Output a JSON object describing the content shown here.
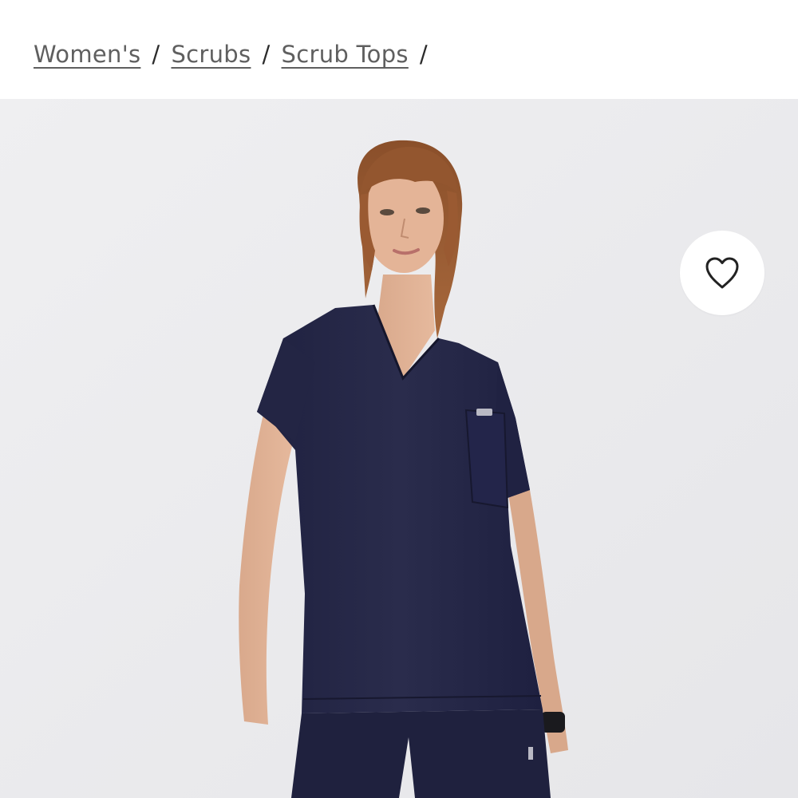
{
  "breadcrumb": {
    "items": [
      {
        "label": "Women's"
      },
      {
        "label": "Scrubs"
      },
      {
        "label": "Scrub Tops"
      }
    ],
    "separator": "/"
  },
  "product_image": {
    "subject": "model wearing navy scrub top",
    "garment_color": "#262845",
    "background_color": "#ececee"
  },
  "favorite": {
    "icon": "heart-outline-icon"
  }
}
